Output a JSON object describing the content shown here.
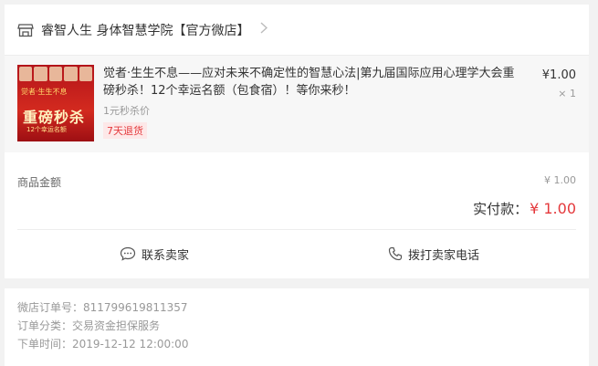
{
  "shop": {
    "name": "睿智人生 身体智慧学院【官方微店】"
  },
  "goods": {
    "title": "觉者·生生不息——应对未来不确定性的智慧心法|第九届国际应用心理学大会重磅秒杀！12个幸运名额（包食宿）！等你来秒！",
    "subtitle": "1元秒杀价",
    "tag": "7天退货",
    "price": "¥1.00",
    "quantity": "× 1",
    "thumb": {
      "brand": "觉者·生生不息",
      "headline": "重磅秒杀",
      "sub": "12个幸运名额"
    }
  },
  "summary": {
    "amount_label": "商品金额",
    "amount_value": "¥ 1.00",
    "paid_label": "实付款：",
    "paid_value": "¥ 1.00"
  },
  "actions": {
    "contact": "联系卖家",
    "call": "拨打卖家电话"
  },
  "order_info": {
    "order_no": "微店订单号：811799619811357",
    "category": "订单分类：交易资金担保服务",
    "time": "下单时间：2019-12-12 12:00:00"
  },
  "colors": {
    "accent": "#e4393c",
    "background": "#f2f2f2"
  }
}
